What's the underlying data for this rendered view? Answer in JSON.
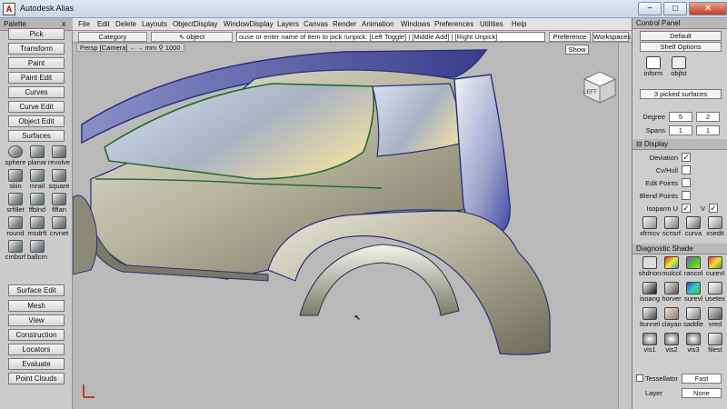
{
  "window": {
    "title": "Autodesk Alias",
    "minimize": "−",
    "maximize": "□",
    "close": "✕"
  },
  "palette": {
    "title": "Palette",
    "close": "x",
    "buttons": {
      "pick": "Pick",
      "transform": "Transform",
      "paint": "Paint",
      "paint_edit": "Paint Edit",
      "curves": "Curves",
      "curve_edit": "Curve Edit",
      "object_edit": "Object Edit",
      "surfaces": "Surfaces",
      "surface_edit": "Surface Edit",
      "mesh": "Mesh",
      "view": "View",
      "construction": "Construction",
      "locators": "Locators",
      "evaluate": "Evaluate",
      "point_clouds": "Point Clouds"
    },
    "tools": [
      "sphere",
      "planar",
      "revolve",
      "skin",
      "mrail",
      "square",
      "srfillet",
      "ffblnd",
      "flflan",
      "round",
      "msdrft",
      "crvnet",
      "cmbsrf",
      "ballcrn"
    ]
  },
  "menubar": [
    "File",
    "Edit",
    "Delete",
    "Layouts",
    "ObjectDisplay",
    "WindowDisplay",
    "Layers",
    "Canvas",
    "Render",
    "Animation",
    "Windows",
    "Preferences",
    "Utilities",
    "Help"
  ],
  "toolbar": {
    "category": "Category",
    "object": "object",
    "prompt": "ouse or enter name of item to pick /unpick: [Left Toggle] | [Middle Add] | [Right Unpick]",
    "preference_sets": "Preference Sets",
    "workspaces": "Workspaces"
  },
  "viewport": {
    "label": "Persp [Camera] ←→ mm  ⚲ 1000",
    "show": "Show",
    "viewcube_face": "LEFT"
  },
  "control_panel": {
    "title": "Control Panel",
    "default": "Default",
    "shelf_options": "Shelf Options",
    "shelf_items": [
      "inform",
      "objlst"
    ],
    "picked": "3 picked surfaces",
    "degree_label": "Degree",
    "degree_u": "5",
    "degree_v": "2",
    "spans_label": "Spans",
    "spans_u": "1",
    "spans_v": "1",
    "display_header": "Display",
    "display_rows": [
      {
        "label": "Deviation",
        "checked": true
      },
      {
        "label": "Cv/Hull",
        "checked": false
      },
      {
        "label": "Edit Points",
        "checked": false
      },
      {
        "label": "Blend Points",
        "checked": false
      },
      {
        "label": "Isoparm U",
        "checked": true
      }
    ],
    "isoparm_v_label": "V",
    "isoparm_v_checked": true,
    "tools_row": [
      "xfrmcv",
      "scnsrf",
      "curva",
      "xsedit"
    ],
    "diag_header": "Diagnostic Shade",
    "diag_tools": [
      "shdnon",
      "mulcol",
      "rancol",
      "curevl",
      "isoang",
      "horver",
      "surevl",
      "usetex",
      "ltunnel",
      "clayao",
      "saddle",
      "vred",
      "vis1",
      "vis2",
      "vis3",
      "filest"
    ],
    "tessellator_label": "Tessellator",
    "tessellator_value": "Fast",
    "layer_label": "Layer",
    "layer_value": "None"
  },
  "colors": {
    "accent": "#3a3aa0",
    "highlight": "#2e7d32"
  }
}
